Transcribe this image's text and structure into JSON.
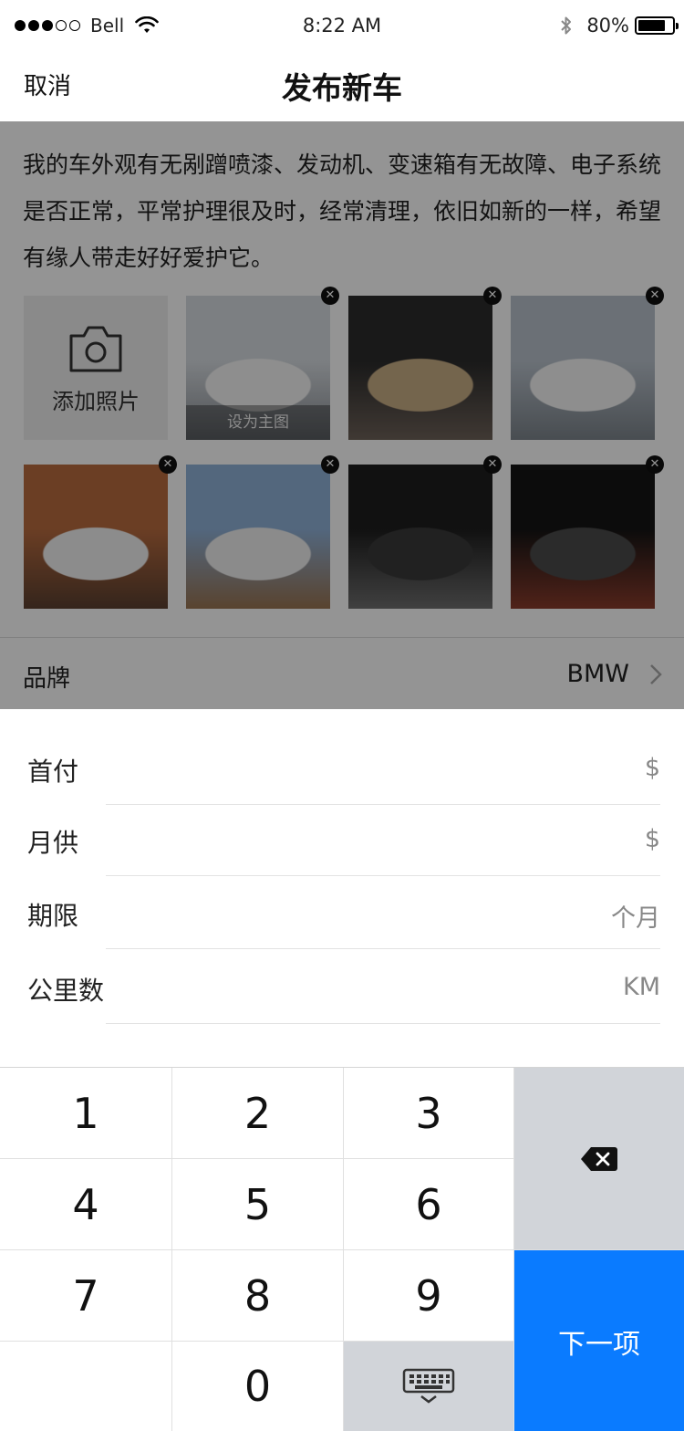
{
  "status_bar": {
    "carrier": "Bell",
    "time": "8:22 AM",
    "battery": "80%",
    "battery_level": 0.8,
    "signal_bars_filled": 3,
    "signal_bars_total": 5
  },
  "nav": {
    "cancel_label": "取消",
    "title": "发布新车"
  },
  "description": "我的车外观有无剐蹭喷漆、发动机、变速箱有无故障、电子系统是否正常，平常护理很及时，经常清理，依旧如新的一样，希望有缘人带走好好爱护它。",
  "photos": {
    "add_label": "添加照片",
    "cover_label": "设为主图",
    "remove_icon": "close-icon",
    "items": [
      {
        "name": "white-porsche-side",
        "colors": [
          "#d6dbe0",
          "#f4f4f4",
          "#8a8f95"
        ]
      },
      {
        "name": "porsche-interior",
        "colors": [
          "#2b2b2b",
          "#c9ae86",
          "#6e6259"
        ]
      },
      {
        "name": "white-porsche-macan",
        "colors": [
          "#b9c2cc",
          "#f5f5f5",
          "#7d858c"
        ]
      },
      {
        "name": "white-bmw-x5-front",
        "colors": [
          "#b86b3f",
          "#f2f2f2",
          "#5b4030"
        ]
      },
      {
        "name": "white-bmw-x5-rear",
        "colors": [
          "#8fb1d8",
          "#efefef",
          "#9a7552"
        ]
      },
      {
        "name": "leather-seat",
        "colors": [
          "#1e1e1e",
          "#3a3a3a",
          "#6f6f6f"
        ]
      },
      {
        "name": "center-console",
        "colors": [
          "#151515",
          "#4a4a4a",
          "#8b3c2c"
        ]
      }
    ]
  },
  "brand": {
    "label": "品牌",
    "value": "BMW"
  },
  "form": [
    {
      "label": "首付",
      "value": "$"
    },
    {
      "label": "月供",
      "value": "$"
    },
    {
      "label": "期限",
      "value": "个月"
    },
    {
      "label": "公里数",
      "value": "KM"
    }
  ],
  "keyboard": {
    "keys": [
      "1",
      "2",
      "3",
      "4",
      "5",
      "6",
      "7",
      "8",
      "9",
      "0"
    ],
    "next_label": "下一项",
    "delete_icon": "backspace-icon",
    "dismiss_icon": "keyboard-dismiss-icon",
    "accent": "#0a7bff"
  }
}
